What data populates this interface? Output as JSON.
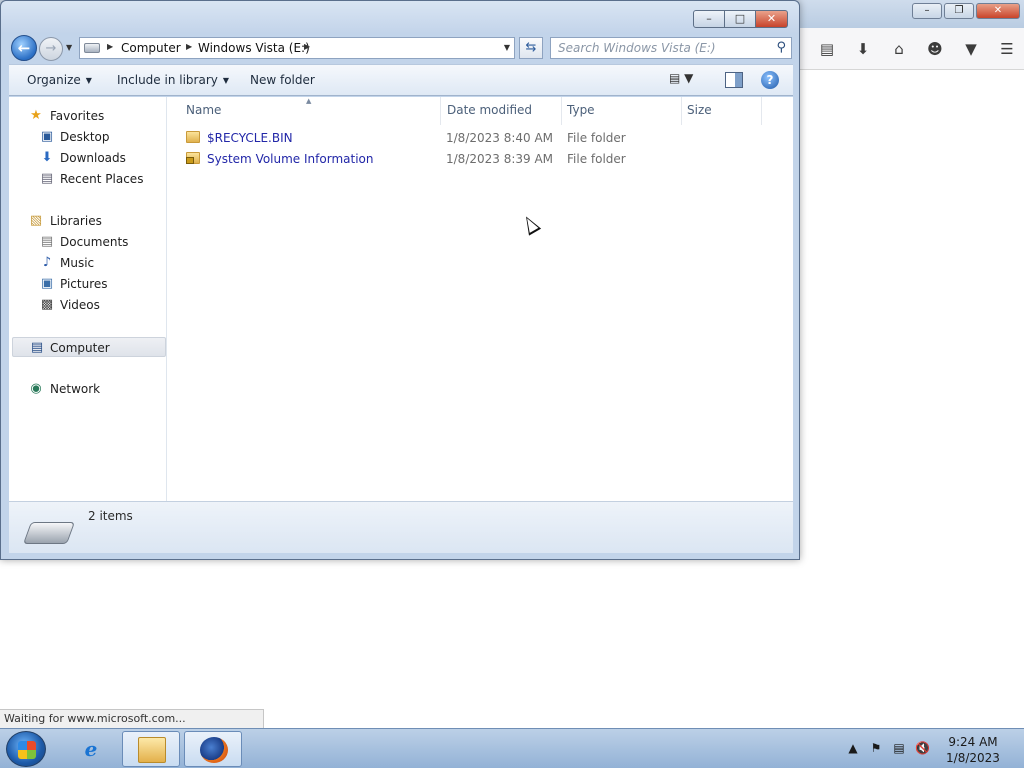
{
  "explorer": {
    "address": {
      "crumbs": [
        "Computer",
        "Windows Vista (E:)"
      ]
    },
    "search_placeholder": "Search Windows Vista (E:)",
    "commands": {
      "organize": "Organize",
      "include_in_library": "Include in library",
      "new_folder": "New folder"
    },
    "nav": {
      "favorites": "Favorites",
      "desktop": "Desktop",
      "downloads": "Downloads",
      "recent_places": "Recent Places",
      "libraries": "Libraries",
      "documents": "Documents",
      "music": "Music",
      "pictures": "Pictures",
      "videos": "Videos",
      "computer": "Computer",
      "network": "Network"
    },
    "columns": {
      "name": "Name",
      "date_modified": "Date modified",
      "type": "Type",
      "size": "Size"
    },
    "files": [
      {
        "name": "$RECYCLE.BIN",
        "date_modified": "1/8/2023 8:40 AM",
        "type": "File folder"
      },
      {
        "name": "System Volume Information",
        "date_modified": "1/8/2023 8:39 AM",
        "type": "File folder"
      }
    ],
    "details": {
      "item_count": "2 items"
    }
  },
  "browser": {
    "status_text": "Waiting for www.microsoft.com..."
  },
  "taskbar": {
    "time": "9:24 AM",
    "date": "1/8/2023"
  }
}
